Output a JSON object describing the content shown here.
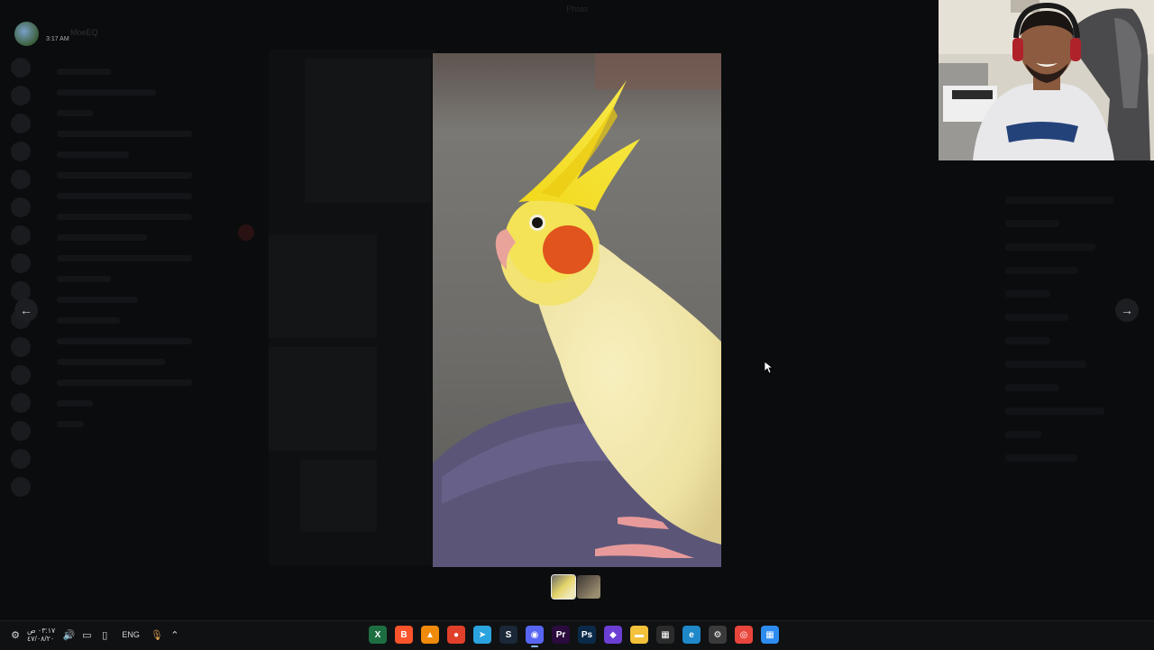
{
  "app": {
    "title": "Photo",
    "time": "3:17 AM",
    "user_name": "MoeEQ",
    "channel_title": "Photo"
  },
  "viewer": {
    "prev_label": "←",
    "next_label": "→",
    "thumbnails": [
      {
        "name": "cockatiel photo",
        "active": true
      },
      {
        "name": "second photo",
        "active": false
      }
    ]
  },
  "taskbar": {
    "clock_time": "٠٣:١٧ ص",
    "clock_date": "٤٧/٠٨/٢٠",
    "language": "ENG",
    "apps": [
      {
        "name": "excel",
        "icon": "excel-icon",
        "color": "#1d6f42",
        "active": false
      },
      {
        "name": "brave",
        "icon": "brave-icon",
        "color": "#fb542b",
        "active": false
      },
      {
        "name": "vlc",
        "icon": "vlc-icon",
        "color": "#f08a0a",
        "active": false
      },
      {
        "name": "record",
        "icon": "record-icon",
        "color": "#e0402a",
        "active": false
      },
      {
        "name": "telegram",
        "icon": "telegram-icon",
        "color": "#2aa3df",
        "active": false
      },
      {
        "name": "steam",
        "icon": "steam-icon",
        "color": "#1b2838",
        "active": false
      },
      {
        "name": "discord",
        "icon": "discord-icon",
        "color": "#5865f2",
        "active": true
      },
      {
        "name": "premiere",
        "icon": "premiere-icon",
        "color": "#2b0a3d",
        "active": false
      },
      {
        "name": "photoshop",
        "icon": "photoshop-icon",
        "color": "#0b2a4a",
        "active": false
      },
      {
        "name": "launcher",
        "icon": "launcher-icon",
        "color": "#6b3fd4",
        "active": false
      },
      {
        "name": "file-explorer",
        "icon": "folder-icon",
        "color": "#f3c13a",
        "active": false
      },
      {
        "name": "store",
        "icon": "store-icon",
        "color": "#2b2b2b",
        "active": false
      },
      {
        "name": "edge",
        "icon": "edge-icon",
        "color": "#1e88c8",
        "active": false
      },
      {
        "name": "settings",
        "icon": "gear-icon",
        "color": "#3a3a3a",
        "active": false
      },
      {
        "name": "chrome",
        "icon": "chrome-icon",
        "color": "#e8453c",
        "active": false
      },
      {
        "name": "start",
        "icon": "windows-icon",
        "color": "#2d8cf0",
        "active": false
      }
    ]
  }
}
